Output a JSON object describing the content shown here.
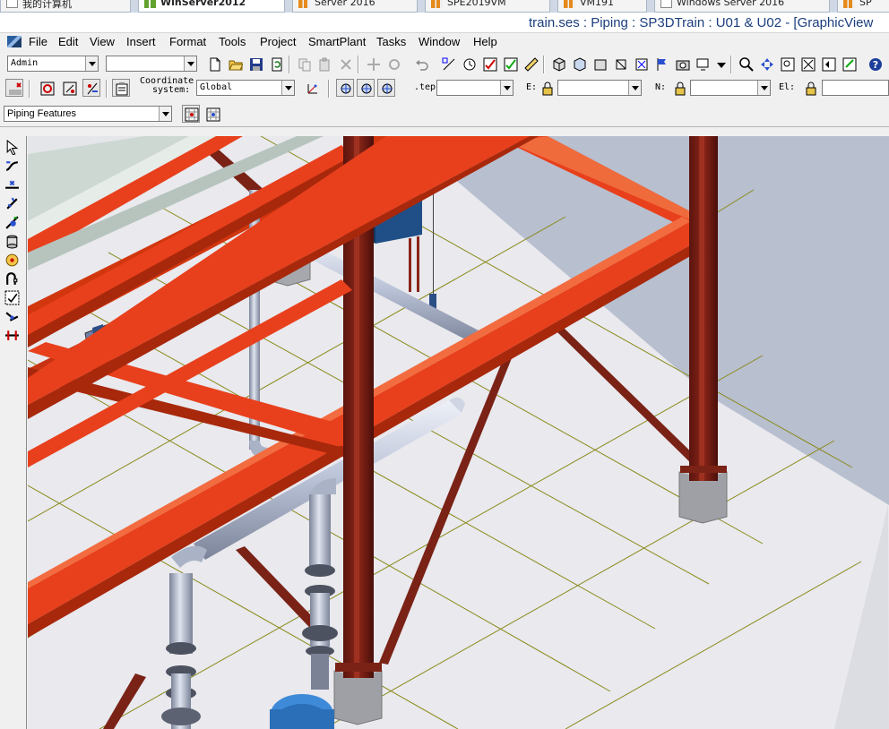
{
  "tabs": [
    {
      "label": "我的计算机",
      "icon": "computer-icon"
    },
    {
      "label": "WinServer2012",
      "icon": "vm-icon",
      "active": true
    },
    {
      "label": "Server 2016",
      "icon": "vm-icon"
    },
    {
      "label": "SPE2019VM",
      "icon": "vm-icon"
    },
    {
      "label": "VM191",
      "icon": "vm-icon"
    },
    {
      "label": "Windows Server 2016",
      "icon": "vm-icon"
    },
    {
      "label": "SP",
      "icon": "vm-icon"
    }
  ],
  "window": {
    "title": "train.ses : Piping : SP3DTrain : U01 & U02 - [GraphicView"
  },
  "menu": [
    "File",
    "Edit",
    "View",
    "Insert",
    "Format",
    "Tools",
    "Project",
    "SmartPlant",
    "Tasks",
    "Window",
    "Help"
  ],
  "toolbar1": {
    "user_combo": "Admin",
    "second_combo": ""
  },
  "toolbar2": {
    "coordinate_label_line1": "Coordinate",
    "coordinate_label_line2": "system:",
    "coordinate_value": "Global",
    "step_label": ".tep:",
    "step_value": "",
    "e_label": "E:",
    "e_value": "",
    "n_label": "N:",
    "n_value": "",
    "el_label": "El:",
    "el_value": ""
  },
  "toolbar3": {
    "filter_combo": "Piping Features"
  },
  "colors": {
    "steel_orange": "#e8401c",
    "steel_dark": "#6b1a12",
    "pipe": "#b9c1d6",
    "floor": "#e9e9ee",
    "wall": "#b8bfcf",
    "grid_line": "#8a8a1a",
    "title_text": "#1b3e7d"
  },
  "left_tools": [
    "select-icon",
    "route-pipe-icon",
    "insert-component-icon",
    "insert-specialty-icon",
    "insert-tap-icon",
    "insert-instrument-icon",
    "insert-feature-icon",
    "insert-split-icon",
    "check-data-icon",
    "connect-icon",
    "insert-spool-break-icon"
  ]
}
